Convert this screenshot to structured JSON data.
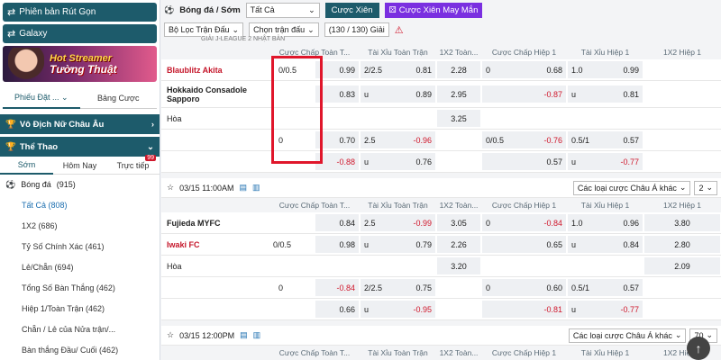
{
  "sidebar": {
    "btn_parlay_version": "Phiên bản Rút Gọn",
    "btn_galaxy": "Galaxy",
    "promo_line1": "Hot Streamer",
    "promo_line2": "Tường Thuật",
    "tabs": [
      "Phiếu Đặt ...",
      "Bảng Cược"
    ],
    "section_euro": "Vô Địch Nữ Châu Âu",
    "section_sports": "Thể Thao",
    "subtabs": [
      "Sớm",
      "Hôm Nay",
      "Trực tiếp"
    ],
    "live_badge": "99",
    "sport": "Bóng đá",
    "sport_count": "(915)",
    "menu": [
      "Tất Cả (808)",
      "1X2 (686)",
      "Tỷ Số Chính Xác (461)",
      "Lẻ/Chẵn (694)",
      "Tổng Số Bàn Thắng (462)",
      "Hiệp 1/Toàn Trận (462)",
      "Chẵn / Lẻ của Nửa trận/...",
      "Bàn thắng Đầu/ Cuối (462)"
    ]
  },
  "topbar": {
    "title": "Bóng đá / Sớm",
    "select_all": "Tất Cả",
    "btn_parlay": "Cược Xiên",
    "btn_lucky": "Cược Xiên May Mắn"
  },
  "filterbar": {
    "filter": "Bộ Lọc Trận Đấu",
    "select_match": "Chọn trận đấu",
    "count": "(130 / 130) Giải",
    "league": "GIẢI J-LEAGUE 2 NHẬT BẢN"
  },
  "columns": [
    "Cược Chấp Toàn T...",
    "Tài Xỉu Toàn Trận",
    "1X2 Toàn...",
    "Cược Chấp Hiệp 1",
    "Tài Xỉu Hiệp 1",
    "1X2 Hiệp 1"
  ],
  "match1": {
    "home": "Blaublitz Akita",
    "away": "Hokkaido Consadole Sapporo",
    "draw": "Hòa",
    "r1": {
      "hcp": "0/0.5",
      "hcp_odd": "0.99",
      "ou_line": "2/2.5",
      "ou_odd": "0.81",
      "x12": "2.28",
      "h1_line": "0",
      "h1_odd": "0.68",
      "h1ou_line": "1.0",
      "h1ou_odd": "0.99"
    },
    "r2": {
      "hcp_odd": "0.83",
      "ou_line": "u",
      "ou_odd": "0.89",
      "x12": "2.95",
      "h1_odd": "-0.87",
      "h1ou_line": "u",
      "h1ou_odd": "0.81"
    },
    "r3": {
      "x12": "3.25"
    },
    "r4": {
      "hcp": "0",
      "hcp_odd": "0.70",
      "ou_line": "2.5",
      "ou_odd": "-0.96",
      "h1_line": "0/0.5",
      "h1_odd": "-0.76",
      "h1ou_line": "0.5/1",
      "h1ou_odd": "0.57"
    },
    "r5": {
      "hcp_odd": "-0.88",
      "ou_line": "u",
      "ou_odd": "0.76",
      "h1_odd": "0.57",
      "h1ou_line": "u",
      "h1ou_odd": "-0.77"
    }
  },
  "match2": {
    "time": "03/15 11:00AM",
    "other_bets": "Các loại cược Châu Á khác",
    "other_count": "2",
    "home": "Fujieda MYFC",
    "away": "Iwaki FC",
    "draw": "Hòa",
    "r1": {
      "hcp_odd": "0.84",
      "ou_line": "2.5",
      "ou_odd": "-0.99",
      "x12": "3.05",
      "h1_line": "0",
      "h1_odd": "-0.84",
      "h1ou_line": "1.0",
      "h1ou_odd": "0.96",
      "h1x12": "3.80"
    },
    "r2": {
      "hcp": "0/0.5",
      "hcp_odd": "0.98",
      "ou_line": "u",
      "ou_odd": "0.79",
      "x12": "2.26",
      "h1_odd": "0.65",
      "h1ou_line": "u",
      "h1ou_odd": "0.84",
      "h1x12": "2.80"
    },
    "r3": {
      "x12": "3.20",
      "h1x12": "2.09"
    },
    "r4": {
      "hcp": "0",
      "hcp_odd": "-0.84",
      "ou_line": "2/2.5",
      "ou_odd": "0.75",
      "h1_line": "0",
      "h1_odd": "0.60",
      "h1ou_line": "0.5/1",
      "h1ou_odd": "0.57"
    },
    "r5": {
      "hcp_odd": "0.66",
      "ou_line": "u",
      "ou_odd": "-0.95",
      "h1_odd": "-0.81",
      "h1ou_line": "u",
      "h1ou_odd": "-0.77"
    }
  },
  "match3": {
    "time": "03/15 12:00PM",
    "other_bets": "Các loại cược Châu Á khác",
    "other_count": "70"
  },
  "colors": {
    "accent": "#1d5b6b",
    "negative": "#d0182c",
    "highlight": "#e0162b"
  }
}
